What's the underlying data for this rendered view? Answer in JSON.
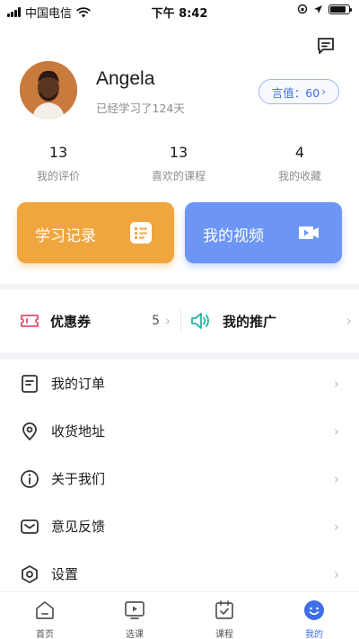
{
  "status_bar": {
    "carrier": "中国电信",
    "time": "下午 8:42"
  },
  "profile": {
    "name": "Angela",
    "studied": "已经学习了124天",
    "score_label": "言值：60"
  },
  "stats": [
    {
      "value": "13",
      "label": "我的评价"
    },
    {
      "value": "13",
      "label": "喜欢的课程"
    },
    {
      "value": "4",
      "label": "我的收藏"
    }
  ],
  "cards": {
    "study_record": "学习记录",
    "my_videos": "我的视频"
  },
  "promo": {
    "coupons_label": "优惠券",
    "coupons_count": "5",
    "promotion_label": "我的推广"
  },
  "menu": [
    {
      "label": "我的订单",
      "icon": "order-icon"
    },
    {
      "label": "收货地址",
      "icon": "location-icon"
    },
    {
      "label": "关于我们",
      "icon": "info-icon"
    },
    {
      "label": "意见反馈",
      "icon": "mail-icon"
    },
    {
      "label": "设置",
      "icon": "settings-icon"
    }
  ],
  "tabs": [
    {
      "label": "首页",
      "icon": "home-icon"
    },
    {
      "label": "选课",
      "icon": "play-icon"
    },
    {
      "label": "课程",
      "icon": "calendar-check-icon"
    },
    {
      "label": "我的",
      "icon": "smile-icon",
      "active": true
    }
  ],
  "colors": {
    "accent": "#3f6fe8",
    "orange_card": "#f0a63f",
    "blue_card": "#6c95f4",
    "coupon_icon": "#e0516b",
    "promo_icon": "#27b5a7"
  }
}
